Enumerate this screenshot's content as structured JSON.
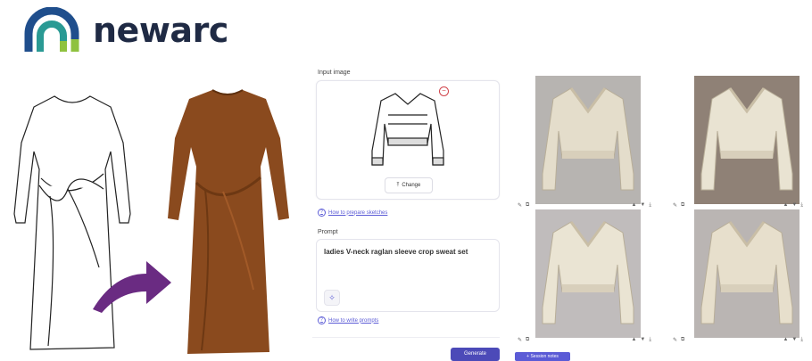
{
  "brand": {
    "name": "newarc",
    "colors": {
      "arc_blue": "#1f4e8c",
      "arc_teal": "#2a9a94",
      "arc_green": "#8fc23f",
      "text": "#1f2a44"
    }
  },
  "form": {
    "input_image_label": "Input image",
    "change_label": "Change",
    "upload_help": "How to prepare sketches",
    "prompt_label": "Prompt",
    "prompt_text": "ladies V-neck raglan sleeve crop sweat set",
    "prompt_help": "How to write prompts",
    "generate_label": "Generate",
    "session_label": "+ Session notes"
  },
  "results": [
    {
      "name": "result-1",
      "bg": "#b7b4b1",
      "garment": "#e4ddcb"
    },
    {
      "name": "result-2",
      "bg": "#8f8176",
      "garment": "#e9e3d2"
    },
    {
      "name": "result-3",
      "bg": "#c0bcbc",
      "garment": "#eae4d3"
    },
    {
      "name": "result-4",
      "bg": "#bab5b3",
      "garment": "#e7dfcc"
    }
  ],
  "icons": {
    "remove": "remove-icon",
    "upload": "upload-icon",
    "help": "help-icon",
    "magic": "sparkle-icon"
  },
  "accent": "#5b5bd6",
  "dress_color": "#8a4a1e"
}
